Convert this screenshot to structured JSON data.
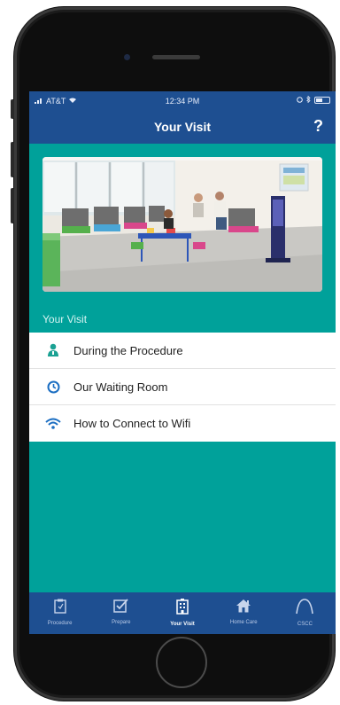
{
  "status_bar": {
    "carrier": "AT&T",
    "time": "12:34 PM"
  },
  "nav": {
    "title": "Your Visit",
    "help_label": "?"
  },
  "section_title": "Your Visit",
  "list_items": [
    {
      "label": "During the Procedure",
      "icon": "doctor-icon"
    },
    {
      "label": "Our Waiting Room",
      "icon": "clock-icon"
    },
    {
      "label": "How to Connect to Wifi",
      "icon": "wifi-icon"
    }
  ],
  "tabs": [
    {
      "label": "Procedure",
      "icon": "clipboard-icon",
      "active": false
    },
    {
      "label": "Prepare",
      "icon": "checkbox-icon",
      "active": false
    },
    {
      "label": "Your Visit",
      "icon": "building-icon",
      "active": true
    },
    {
      "label": "Home Care",
      "icon": "home-icon",
      "active": false
    },
    {
      "label": "CSCC",
      "icon": "arch-logo-icon",
      "active": false
    }
  ],
  "colors": {
    "primary": "#1e4f91",
    "teal": "#00a19a",
    "icon_accent": "#1b6ec2"
  }
}
